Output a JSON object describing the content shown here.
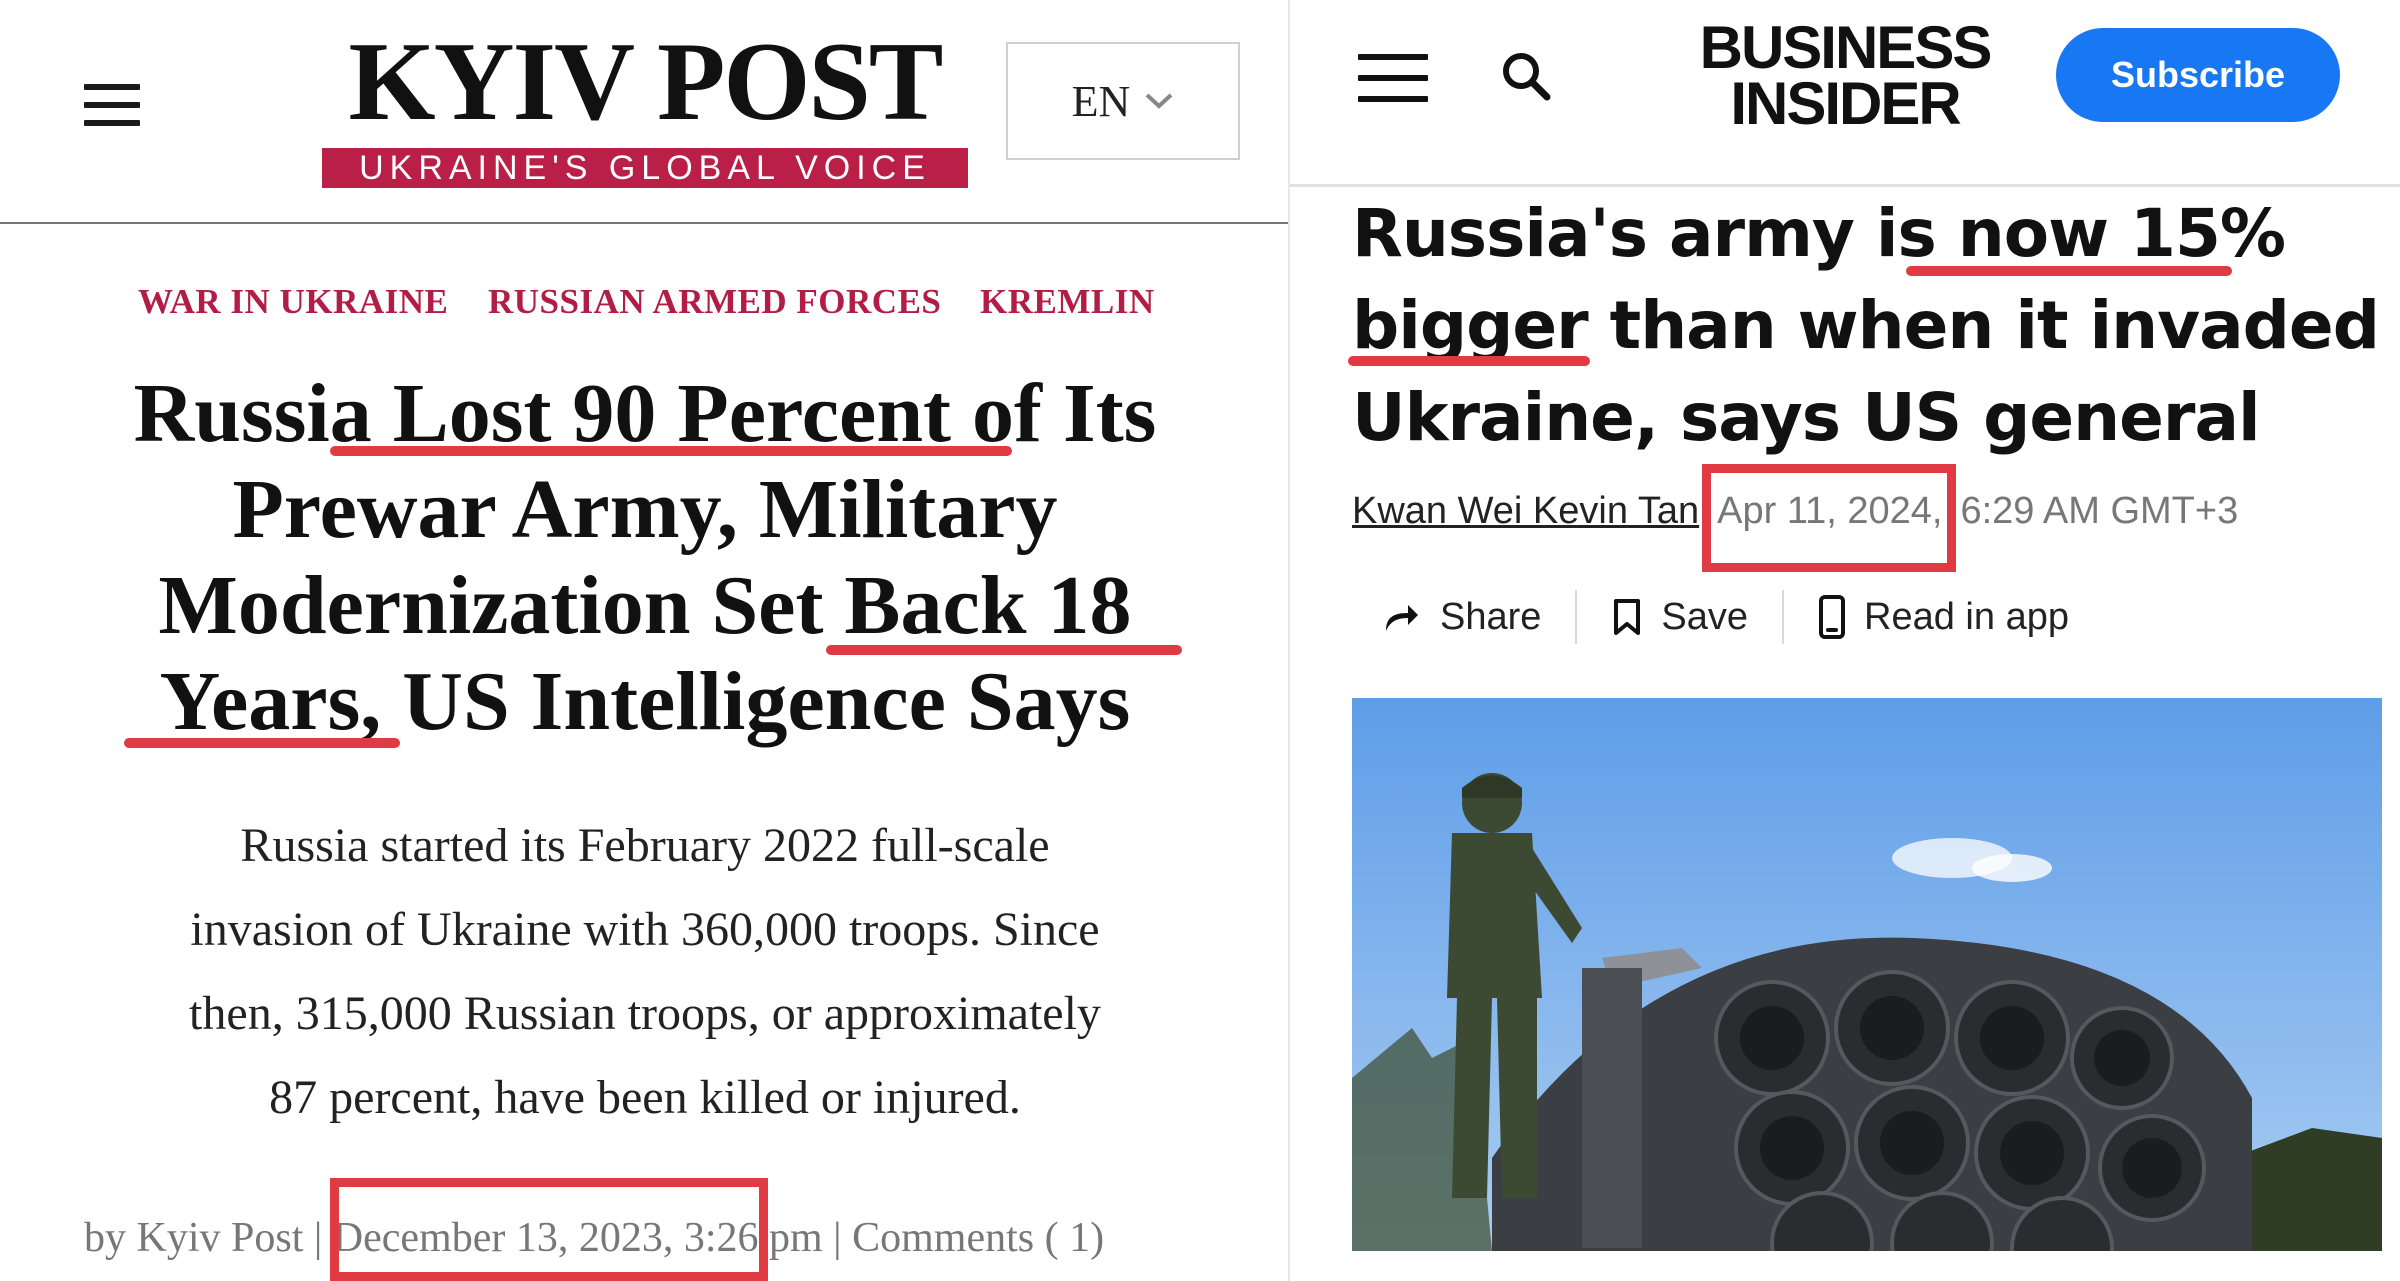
{
  "kyiv_post": {
    "logo": "KYIV POST",
    "tagline": "UKRAINE'S GLOBAL VOICE",
    "language": "EN",
    "categories": [
      "WAR IN UKRAINE",
      "RUSSIAN ARMED FORCES",
      "KREMLIN"
    ],
    "headline": {
      "line1": "Russia Lost 90 Percent of Its",
      "line2": "Prewar Army, Military",
      "line3": "Modernization Set Back 18",
      "line4": "Years, US Intelligence Says"
    },
    "summary": {
      "line1": "Russia started its February 2022 full-scale",
      "line2": "invasion of Ukraine with 360,000 troops. Since",
      "line3": "then, 315,000 Russian troops, or approximately",
      "line4": "87 percent, have been killed or injured."
    },
    "byline": {
      "prefix": "by Kyiv Post |",
      "date": "December 13, 2023,",
      "rest": "3:26 pm | Comments ( 1)"
    },
    "accent_color": "#b21d45"
  },
  "business_insider": {
    "logo_line1": "BUSINESS",
    "logo_line2": "INSIDER",
    "subscribe_label": "Subscribe",
    "headline": {
      "line1": "Russia's army is now 15%",
      "line2": "bigger than when it invaded",
      "line3": "Ukraine, says US general"
    },
    "author": "Kwan Wei Kevin Tan",
    "date": "Apr 11, 2024,",
    "time": "6:29 AM GMT+3",
    "actions": {
      "share": "Share",
      "save": "Save",
      "read_in_app": "Read in app"
    },
    "accent_color": "#1877f2"
  },
  "annotation_color": "#e03b42"
}
